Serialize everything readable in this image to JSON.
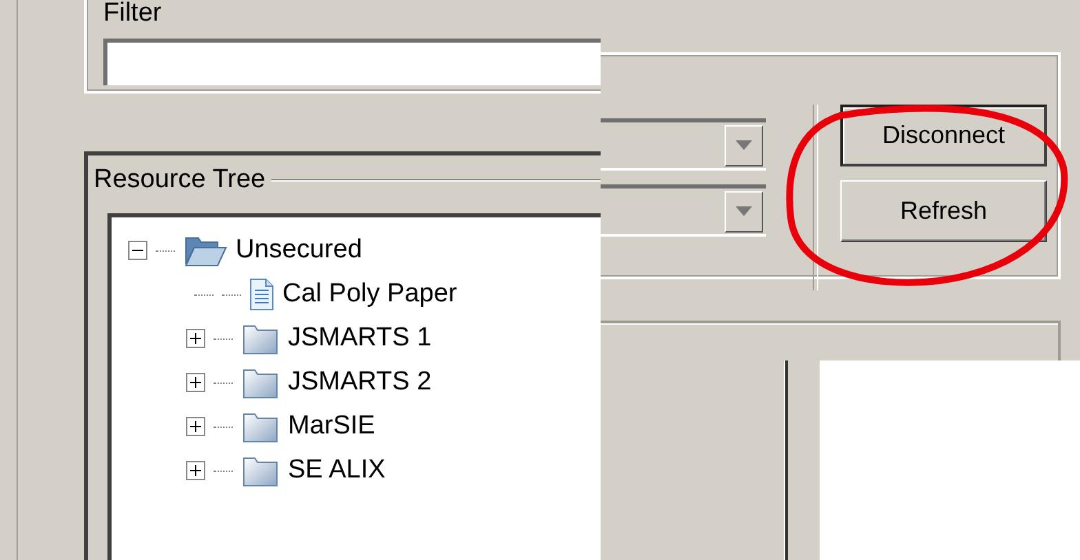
{
  "filter": {
    "label": "Filter"
  },
  "resource_tree": {
    "title": "Resource Tree",
    "items": [
      {
        "label": "Unsecured",
        "kind": "folder",
        "expanded": true,
        "children": [
          {
            "label": "Cal Poly Paper",
            "kind": "document"
          },
          {
            "label": "JSMARTS 1",
            "kind": "folder",
            "expanded": false
          },
          {
            "label": "JSMARTS 2",
            "kind": "folder",
            "expanded": false
          },
          {
            "label": "MarSIE",
            "kind": "folder",
            "expanded": false
          },
          {
            "label": "SE ALIX",
            "kind": "folder",
            "expanded": false
          }
        ]
      }
    ]
  },
  "buttons": [
    {
      "label": "Disconnect",
      "default": true
    },
    {
      "label": "Refresh",
      "default": false
    }
  ]
}
